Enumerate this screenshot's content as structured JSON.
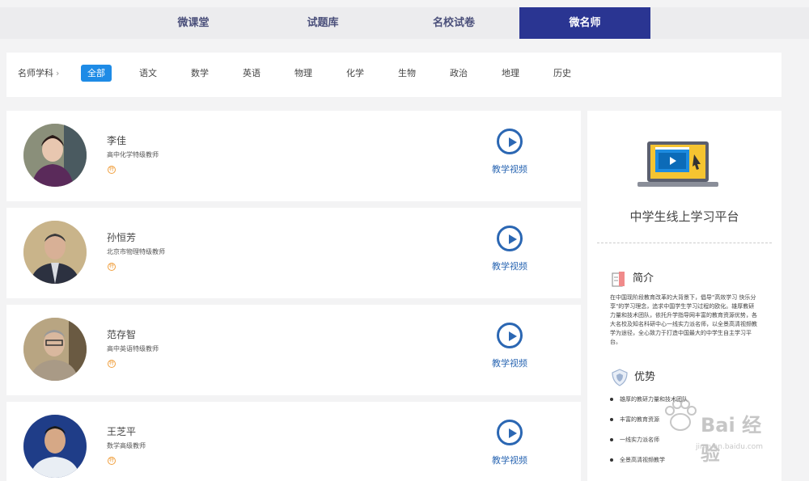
{
  "tabs": [
    {
      "label": "微课堂",
      "active": false
    },
    {
      "label": "试题库",
      "active": false
    },
    {
      "label": "名校试卷",
      "active": false
    },
    {
      "label": "微名师",
      "active": true
    }
  ],
  "filter": {
    "title": "名师学科",
    "subjects": [
      "全部",
      "语文",
      "数学",
      "英语",
      "物理",
      "化学",
      "生物",
      "政治",
      "地理",
      "历史"
    ],
    "active": "全部"
  },
  "teachers": [
    {
      "name": "李佳",
      "title": "高中化学特级教师",
      "badge": "特",
      "video_label": "教学视频"
    },
    {
      "name": "孙恒芳",
      "title": "北京市物理特级教师",
      "badge": "特",
      "video_label": "教学视频"
    },
    {
      "name": "范存智",
      "title": "高中英语特级教师",
      "badge": "特",
      "video_label": "教学视频"
    },
    {
      "name": "王芝平",
      "title": "数学高级教师",
      "badge": "特",
      "video_label": "教学视频"
    }
  ],
  "sidebar": {
    "platform_title": "中学生线上学习平台",
    "intro_heading": "简介",
    "intro_text": "在中国现阶段教育改革的大背景下，倡导\"高效学习 快乐分享\"的学习理念，追求中国学生学习过程的欧化。雄厚教研力量和技术团队，依托升学指导网丰富的教育资源优势，各大名校及知名科研中心一线实力派名师，以全景高清视频教学为途径，全心致力于打造中国最大的中学生自主学习平台。",
    "adv_heading": "优势",
    "advantages": [
      "雄厚的教研力量和技术团队",
      "丰富的教育资源",
      "一线实力派名师",
      "全景高清视频教学"
    ]
  },
  "watermark": {
    "text": "Bai 经验",
    "url": "jingyan.baidu.com"
  },
  "colors": {
    "active_tab": "#2a3592",
    "active_subject": "#1e8be6",
    "play": "#2b67b3",
    "badge": "#f0a040"
  }
}
